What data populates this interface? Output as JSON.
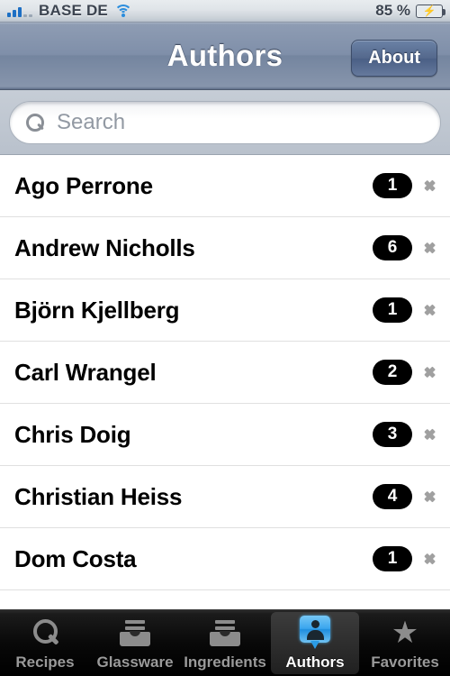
{
  "status_bar": {
    "signal_icon": "signal-bars-icon",
    "signal_bars_filled": 3,
    "signal_bars_total": 5,
    "carrier": "BASE DE",
    "wifi_icon": "wifi-icon",
    "battery_percent": "85 %",
    "battery_icon": "battery-charging-icon",
    "battery_color": "#37a80e",
    "charging_glyph": "⚡"
  },
  "nav_bar": {
    "title": "Authors",
    "about_label": "About"
  },
  "search": {
    "placeholder": "Search",
    "value": "",
    "icon": "search-icon"
  },
  "list": {
    "rows": [
      {
        "name": "Ago Perrone",
        "count": "1"
      },
      {
        "name": "Andrew Nicholls",
        "count": "6"
      },
      {
        "name": "Björn Kjellberg",
        "count": "1"
      },
      {
        "name": "Carl Wrangel",
        "count": "2"
      },
      {
        "name": "Chris Doig",
        "count": "3"
      },
      {
        "name": "Christian Heiss",
        "count": "4"
      },
      {
        "name": "Dom Costa",
        "count": "1"
      },
      {
        "name": "",
        "count": ""
      }
    ]
  },
  "tab_bar": {
    "selected_index": 3,
    "tabs": [
      {
        "label": "Recipes",
        "icon": "magnifier-icon"
      },
      {
        "label": "Glassware",
        "icon": "card-box-icon"
      },
      {
        "label": "Ingredients",
        "icon": "card-box-icon"
      },
      {
        "label": "Authors",
        "icon": "person-pin-icon"
      },
      {
        "label": "Favorites",
        "icon": "star-icon"
      }
    ]
  }
}
